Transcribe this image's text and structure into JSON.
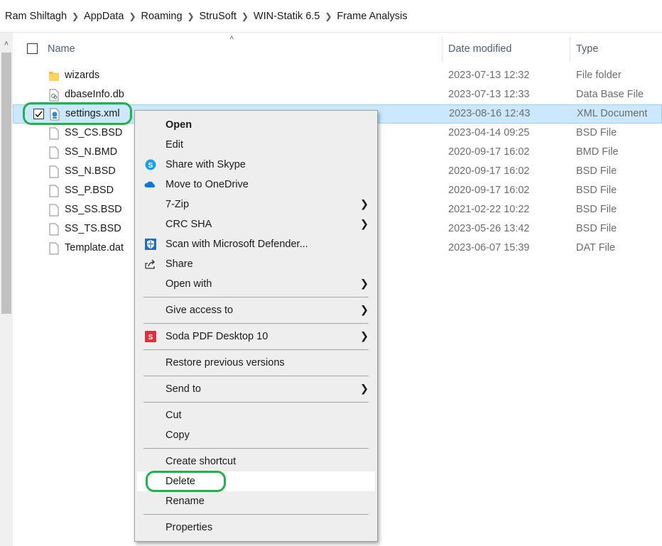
{
  "breadcrumb": [
    "Ram Shiltagh",
    "AppData",
    "Roaming",
    "StruSoft",
    "WIN-Statik 6.5",
    "Frame Analysis"
  ],
  "columns": {
    "name": "Name",
    "date": "Date modified",
    "type": "Type"
  },
  "files": [
    {
      "name": "wizards",
      "date": "2023-07-13 12:32",
      "type": "File folder",
      "icon": "folder-icon"
    },
    {
      "name": "dbaseInfo.db",
      "date": "2023-07-13 12:33",
      "type": "Data Base File",
      "icon": "database-file-icon"
    },
    {
      "name": "settings.xml",
      "date": "2023-08-16 12:43",
      "type": "XML Document",
      "icon": "xml-file-icon",
      "selected": true
    },
    {
      "name": "SS_CS.BSD",
      "date": "2023-04-14 09:25",
      "type": "BSD File",
      "icon": "file-icon"
    },
    {
      "name": "SS_N.BMD",
      "date": "2020-09-17 16:02",
      "type": "BMD File",
      "icon": "file-icon"
    },
    {
      "name": "SS_N.BSD",
      "date": "2020-09-17 16:02",
      "type": "BSD File",
      "icon": "file-icon"
    },
    {
      "name": "SS_P.BSD",
      "date": "2020-09-17 16:02",
      "type": "BSD File",
      "icon": "file-icon"
    },
    {
      "name": "SS_SS.BSD",
      "date": "2021-02-22 10:22",
      "type": "BSD File",
      "icon": "file-icon"
    },
    {
      "name": "SS_TS.BSD",
      "date": "2023-05-26 13:42",
      "type": "BSD File",
      "icon": "file-icon"
    },
    {
      "name": "Template.dat",
      "date": "2023-06-07 15:39",
      "type": "DAT File",
      "icon": "file-icon"
    }
  ],
  "menu": {
    "open": "Open",
    "edit": "Edit",
    "share_skype": "Share with Skype",
    "onedrive": "Move to OneDrive",
    "zip": "7-Zip",
    "crc": "CRC SHA",
    "defender": "Scan with Microsoft Defender...",
    "share": "Share",
    "open_with": "Open with",
    "give_access": "Give access to",
    "soda": "Soda PDF Desktop 10",
    "restore": "Restore previous versions",
    "send_to": "Send to",
    "cut": "Cut",
    "copy": "Copy",
    "create_shortcut": "Create shortcut",
    "delete": "Delete",
    "rename": "Rename",
    "properties": "Properties"
  },
  "colors": {
    "selection": "#cce8ff",
    "highlight_ring": "#22b14c",
    "menu_bg": "#eeeeee"
  }
}
